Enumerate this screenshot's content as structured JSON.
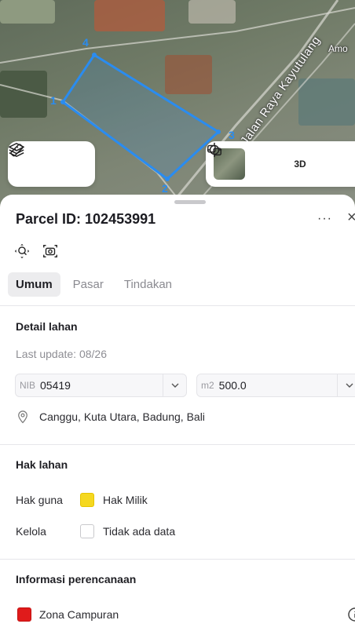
{
  "map": {
    "street_name": "Jalan Raya Kayutulang",
    "place_label": "Amo",
    "vertices": [
      "1",
      "2",
      "3",
      "4"
    ],
    "parcel_color": "#2a8cf0",
    "controls": {
      "layers_icon": "layers-icon",
      "measure_icon": "ruler-icon",
      "basemap_icon": "basemap-thumbnail",
      "locate_icon": "crosshair-icon",
      "threed_label": "3D",
      "share_icon": "share-icon"
    }
  },
  "sheet": {
    "parcel_title": "Parcel ID: 102453991",
    "more_label": "···",
    "close_label": "×",
    "tabs": [
      {
        "label": "Umum",
        "active": true
      },
      {
        "label": "Pasar",
        "active": false
      },
      {
        "label": "Tindakan",
        "active": false
      }
    ],
    "detail": {
      "title": "Detail lahan",
      "last_update": "Last update: 08/26",
      "nib_prefix": "NIB",
      "nib_value": "05419",
      "area_prefix": "m2",
      "area_value": "500.0",
      "location": "Canggu, Kuta Utara, Badung, Bali"
    },
    "rights": {
      "title": "Hak lahan",
      "rows": [
        {
          "label": "Hak guna",
          "value": "Hak Milik",
          "color": "#f5d820"
        },
        {
          "label": "Kelola",
          "value": "Tidak ada data",
          "color": "#ffffff"
        }
      ]
    },
    "planning": {
      "title": "Informasi perencanaan",
      "zone": "Zona Campuran",
      "zone_color": "#e01b1b"
    }
  }
}
